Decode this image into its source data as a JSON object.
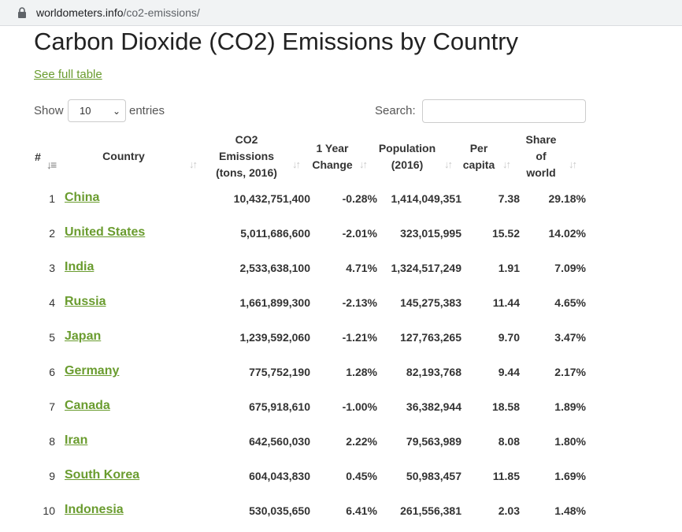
{
  "browser": {
    "url_domain": "worldometers.info",
    "url_path": "/co2-emissions/"
  },
  "page": {
    "title": "Carbon Dioxide (CO2) Emissions by Country",
    "full_table_link": "See full table"
  },
  "controls": {
    "show_label": "Show",
    "entries_value": "10",
    "entries_label": "entries",
    "search_label": "Search:",
    "search_value": ""
  },
  "table": {
    "headers": {
      "rank": "#",
      "country": "Country",
      "co2": [
        "CO2",
        "Emissions",
        "(tons, 2016)"
      ],
      "change": [
        "1 Year",
        "Change"
      ],
      "population": [
        "Population",
        "(2016)"
      ],
      "per_capita": [
        "Per",
        "capita"
      ],
      "share": [
        "Share",
        "of",
        "world"
      ]
    },
    "rows": [
      {
        "rank": "1",
        "country": "China",
        "co2": "10,432,751,400",
        "change": "-0.28%",
        "population": "1,414,049,351",
        "per_capita": "7.38",
        "share": "29.18%"
      },
      {
        "rank": "2",
        "country": "United States",
        "co2": "5,011,686,600",
        "change": "-2.01%",
        "population": "323,015,995",
        "per_capita": "15.52",
        "share": "14.02%"
      },
      {
        "rank": "3",
        "country": "India",
        "co2": "2,533,638,100",
        "change": "4.71%",
        "population": "1,324,517,249",
        "per_capita": "1.91",
        "share": "7.09%"
      },
      {
        "rank": "4",
        "country": "Russia",
        "co2": "1,661,899,300",
        "change": "-2.13%",
        "population": "145,275,383",
        "per_capita": "11.44",
        "share": "4.65%"
      },
      {
        "rank": "5",
        "country": "Japan",
        "co2": "1,239,592,060",
        "change": "-1.21%",
        "population": "127,763,265",
        "per_capita": "9.70",
        "share": "3.47%"
      },
      {
        "rank": "6",
        "country": "Germany",
        "co2": "775,752,190",
        "change": "1.28%",
        "population": "82,193,768",
        "per_capita": "9.44",
        "share": "2.17%"
      },
      {
        "rank": "7",
        "country": "Canada",
        "co2": "675,918,610",
        "change": "-1.00%",
        "population": "36,382,944",
        "per_capita": "18.58",
        "share": "1.89%"
      },
      {
        "rank": "8",
        "country": "Iran",
        "co2": "642,560,030",
        "change": "2.22%",
        "population": "79,563,989",
        "per_capita": "8.08",
        "share": "1.80%"
      },
      {
        "rank": "9",
        "country": "South Korea",
        "co2": "604,043,830",
        "change": "0.45%",
        "population": "50,983,457",
        "per_capita": "11.85",
        "share": "1.69%"
      },
      {
        "rank": "10",
        "country": "Indonesia",
        "co2": "530,035,650",
        "change": "6.41%",
        "population": "261,556,381",
        "per_capita": "2.03",
        "share": "1.48%"
      }
    ]
  },
  "colors": {
    "link": "#6a9c2f",
    "sort_inactive": "#c8c8c8",
    "sort_active": "#777777"
  },
  "icons": {
    "lock": "lock-icon",
    "sort": "sort-arrows-icon",
    "sort_active": "sort-asc-icon",
    "dropdown": "chevron-down-icon"
  }
}
